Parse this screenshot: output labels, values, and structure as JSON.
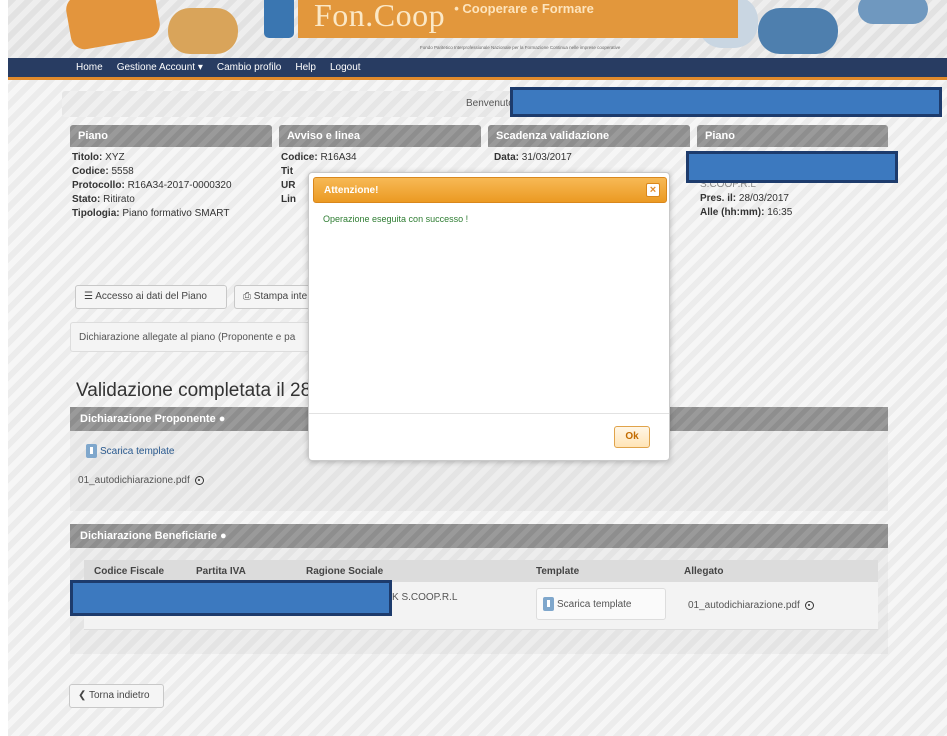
{
  "header": {
    "logo_text": "Fon.Coop",
    "tagline": "• Cooperare e Formare",
    "subtitle": "Fondo Paritetico Interprofessionale Nazionale per la Formazione Continua nelle imprese cooperative"
  },
  "nav": {
    "home": "Home",
    "account": "Gestione Account",
    "account_caret": "▾",
    "profile": "Cambio profilo",
    "help": "Help",
    "logout": "Logout"
  },
  "welcome": {
    "label": "Benvenuto"
  },
  "panels": {
    "piano": {
      "title": "Piano",
      "titolo_label": "Titolo:",
      "titolo": "XYZ",
      "codice_label": "Codice:",
      "codice": "5558",
      "protocollo_label": "Protocollo:",
      "protocollo": "R16A34-2017-0000320",
      "stato_label": "Stato:",
      "stato": "Ritirato",
      "tipologia_label": "Tipologia:",
      "tipologia": "Piano formativo SMART"
    },
    "avviso": {
      "title": "Avviso e linea",
      "codice_label": "Codice:",
      "codice": "R16A34",
      "line2": "Tit",
      "line3": "UR",
      "line4": "Lin"
    },
    "scadenza": {
      "title": "Scadenza validazione",
      "data_label": "Data:",
      "data": "31/03/2017"
    },
    "piano2": {
      "title": "Piano",
      "partial": "S.COOP.R.L",
      "pres_label": "Pres. il:",
      "pres": "28/03/2017",
      "alle_label": "Alle (hh:mm):",
      "alle": "16:35"
    }
  },
  "buttons": {
    "accesso": "Accesso ai dati del Piano",
    "stampa": "Stampa inte",
    "torna": "Torna indietro"
  },
  "dichiarazione_bar": "Dichiarazione allegate al piano (Proponente e pa",
  "validation_title": "Validazione completata il 28/0",
  "proponente": {
    "title": "Dichiarazione Proponente",
    "scarica": "Scarica template",
    "file": "01_autodichiarazione.pdf"
  },
  "beneficiarie": {
    "title": "Dichiarazione Beneficiarie",
    "columns": [
      "Codice Fiscale",
      "Partita IVA",
      "Ragione Sociale",
      "Template",
      "Allegato"
    ],
    "row": {
      "ragione_sociale": "K S.COOP.R.L",
      "template": "Scarica template",
      "allegato": "01_autodichiarazione.pdf"
    }
  },
  "dialog": {
    "title": "Attenzione!",
    "close": "×",
    "message": "Operazione eseguita con successo !",
    "ok": "Ok"
  },
  "colors": {
    "navbar": "#283c62",
    "accent_orange": "#eb9a23",
    "mask_blue": "#3c79bf",
    "success_green": "#2e7d32"
  }
}
